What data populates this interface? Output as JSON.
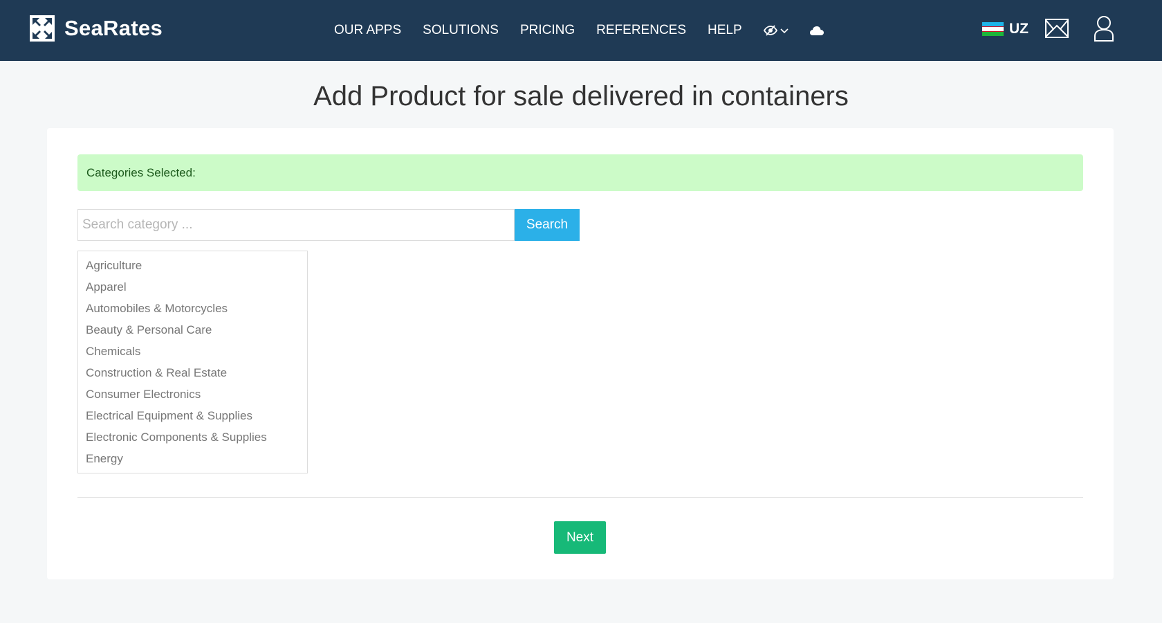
{
  "header": {
    "brand": "SeaRates",
    "nav": [
      {
        "label": "OUR APPS"
      },
      {
        "label": "SOLUTIONS"
      },
      {
        "label": "PRICING"
      },
      {
        "label": "REFERENCES"
      },
      {
        "label": "HELP"
      }
    ],
    "icons": [
      "eye-slash-icon",
      "chevron-down-icon",
      "cloud-icon",
      "mail-icon",
      "user-icon"
    ],
    "language": "UZ",
    "colors": {
      "bar": "#1f3a55"
    }
  },
  "page": {
    "title": "Add Product for sale delivered in containers"
  },
  "alert": {
    "text": "Categories Selected:"
  },
  "search": {
    "placeholder": "Search category ...",
    "value": "",
    "button": "Search"
  },
  "categories": [
    "Agriculture",
    "Apparel",
    "Automobiles & Motorcycles",
    "Beauty & Personal Care",
    "Chemicals",
    "Construction & Real Estate",
    "Consumer Electronics",
    "Electrical Equipment & Supplies",
    "Electronic Components & Supplies",
    "Energy"
  ],
  "actions": {
    "next": "Next"
  },
  "colors": {
    "alert_bg": "#ccfbc8",
    "search_button": "#2bb0e8",
    "next_button": "#17b978"
  }
}
